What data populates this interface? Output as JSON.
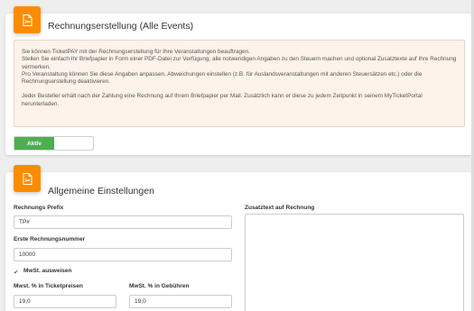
{
  "section1": {
    "title": "Rechnungserstellung (Alle Events)",
    "info_lines_1": [
      "Sie können TicketPAY mit der Rechnungserstellung für Ihre Veranstaltungen beauftragen.",
      "Stellen Sie einfach Ihr Briefpapier in Form einer PDF-Datei zur Verfügung, alle notwendigen Angaben zu den Steuern machen und optional Zusatztexte auf Ihre Rechnung vermerken.",
      "Pro Veranstaltung können Sie diese Angaben anpassen, Abweichungen einstellen (z.B. für Auslandsveranstaltungen mit anderen Steuersätzen etc.) oder die Rechnungserstellung deaktivieren."
    ],
    "info_line_2": "Jeder Besteller erhält nach der Zahlung eine Rechnung auf Ihrem Briefpapier per Mail. Zusätzlich kann er diese zu jedem Zeitpunkt in seinem MyTicketPortal herunterladen.",
    "toggle_label": "Aktiv"
  },
  "section2": {
    "title": "Allgemeine Einstellungen",
    "prefix_label": "Rechnungs Prefix",
    "prefix_value": "TP#",
    "first_number_label": "Erste Rechnungsnummer",
    "first_number_value": "10000",
    "mwst_checkbox_label": "MwSt. ausweisen",
    "mwst_ticket_label": "Mwst. % in Ticketpreisen",
    "mwst_ticket_value": "19,0",
    "mwst_fee_label": "MwSt. % in Gebühren",
    "mwst_fee_value": "19,0",
    "extra_text_label": "Zusatztext auf Rechnung"
  },
  "colors": {
    "accent": "#fb8c00",
    "active_green": "#4caf50",
    "info_bg": "#fdf3ea"
  },
  "icons": {
    "section_icon": "document-icon"
  }
}
